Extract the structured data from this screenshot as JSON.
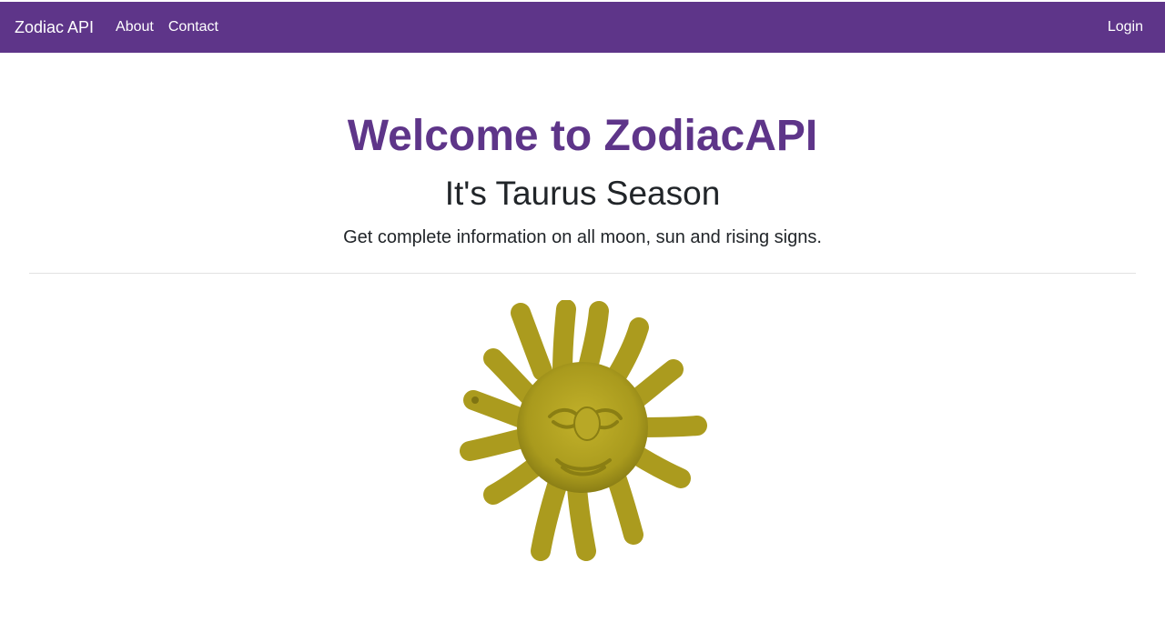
{
  "navbar": {
    "brand": "Zodiac API",
    "links": [
      "About",
      "Contact"
    ],
    "login": "Login",
    "background": "#5e3589"
  },
  "hero": {
    "title": "Welcome to ZodiacAPI",
    "subtitle": "It's Taurus Season",
    "lead": "Get complete information on all moon, sun and rising signs."
  },
  "image": {
    "icon": "sun-icon",
    "color": "#a99a1d"
  }
}
